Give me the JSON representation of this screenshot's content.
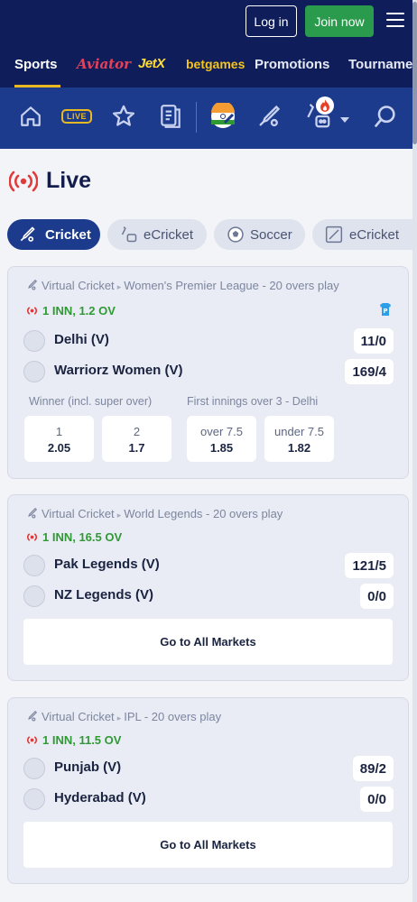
{
  "header": {
    "login_label": "Log in",
    "join_label": "Join now"
  },
  "product_nav": {
    "items": [
      {
        "label": "Sports",
        "active": true
      },
      {
        "label": "Aviator"
      },
      {
        "label": "JetX"
      },
      {
        "label": "betgames"
      },
      {
        "label": "Promotions"
      },
      {
        "label": "Tourname"
      }
    ]
  },
  "icon_nav": {
    "items": [
      {
        "name": "home-icon"
      },
      {
        "name": "live-icon",
        "label": "LIVE"
      },
      {
        "name": "star-icon"
      },
      {
        "name": "betslip-icon"
      },
      {
        "name": "india-cricket-icon"
      },
      {
        "name": "cricket-icon"
      },
      {
        "name": "ecricket-icon"
      },
      {
        "name": "search-icon"
      }
    ]
  },
  "live": {
    "title": "Live"
  },
  "chips": [
    {
      "label": "Cricket",
      "active": true
    },
    {
      "label": "eCricket"
    },
    {
      "label": "Soccer"
    },
    {
      "label": "eCricket"
    }
  ],
  "events": [
    {
      "sport": "Virtual Cricket",
      "league": "Women's Premier League - 20 overs play",
      "status": "1 INN, 1.2 OV",
      "team1": {
        "name": "Delhi (V)",
        "score": "11/0"
      },
      "team2": {
        "name": "Warriorz Women (V)",
        "score": "169/4"
      },
      "market1": {
        "title": "Winner (incl. super over)",
        "odds": [
          {
            "label": "1",
            "value": "2.05"
          },
          {
            "label": "2",
            "value": "1.7"
          }
        ]
      },
      "market2": {
        "title": "First innings over 3 - Delhi",
        "odds": [
          {
            "label": "over 7.5",
            "value": "1.85"
          },
          {
            "label": "under 7.5",
            "value": "1.82"
          }
        ]
      }
    },
    {
      "sport": "Virtual Cricket",
      "league": "World Legends - 20 overs play",
      "status": "1 INN, 16.5 OV",
      "team1": {
        "name": "Pak Legends (V)",
        "score": "121/5"
      },
      "team2": {
        "name": "NZ Legends (V)",
        "score": "0/0"
      },
      "all_markets_label": "Go to All Markets"
    },
    {
      "sport": "Virtual Cricket",
      "league": "IPL - 20 overs play",
      "status": "1 INN, 11.5 OV",
      "team1": {
        "name": "Punjab (V)",
        "score": "89/2"
      },
      "team2": {
        "name": "Hyderabad (V)",
        "score": "0/0"
      },
      "all_markets_label": "Go to All Markets"
    }
  ],
  "colors": {
    "header_bg": "#0f1e5a",
    "icon_nav_bg": "#1d3b8d",
    "join_green": "#2a9a4c",
    "accent_yellow": "#e8b923",
    "live_red": "#e03a3a",
    "status_green": "#2f9a34"
  }
}
